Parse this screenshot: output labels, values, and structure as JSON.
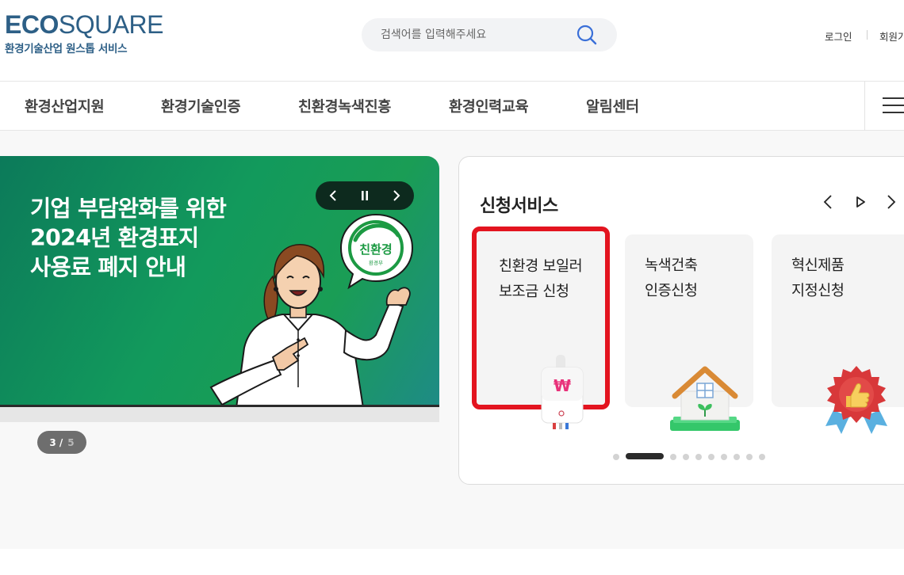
{
  "header": {
    "logo_eco": "ECO",
    "logo_square": "SQUARE",
    "logo_sub": "환경기술산업 원스톱 서비스",
    "search_placeholder": "검색어를 입력해주세요",
    "login": "로그인",
    "signup": "회원가"
  },
  "gnb": {
    "items": [
      "환경산업지원",
      "환경기술인증",
      "친환경녹색진흥",
      "환경인력교육",
      "알림센터"
    ]
  },
  "banner": {
    "lines": [
      "기업 부담완화를 위한",
      "2024년 환경표지",
      "사용료 폐지 안내"
    ],
    "badge_main": "친환경",
    "badge_sub": "환경부",
    "pager_current": "3 /",
    "pager_total": "5"
  },
  "services": {
    "title": "신청서비스",
    "cards": [
      {
        "line1": "친환경 보일러",
        "line2": "보조금 신청",
        "icon": "boiler-icon"
      },
      {
        "line1": "녹색건축",
        "line2": "인증신청",
        "icon": "house-icon"
      },
      {
        "line1": "혁신제품",
        "line2": "지정신청",
        "icon": "thumbs-up-badge-icon"
      }
    ],
    "boiler_symbol": "₩",
    "dot_count": 10,
    "active_dot": 1
  },
  "colors": {
    "brand": "#2d5f86",
    "banner_green": "#129a5c",
    "highlight_red": "#e3141f"
  }
}
